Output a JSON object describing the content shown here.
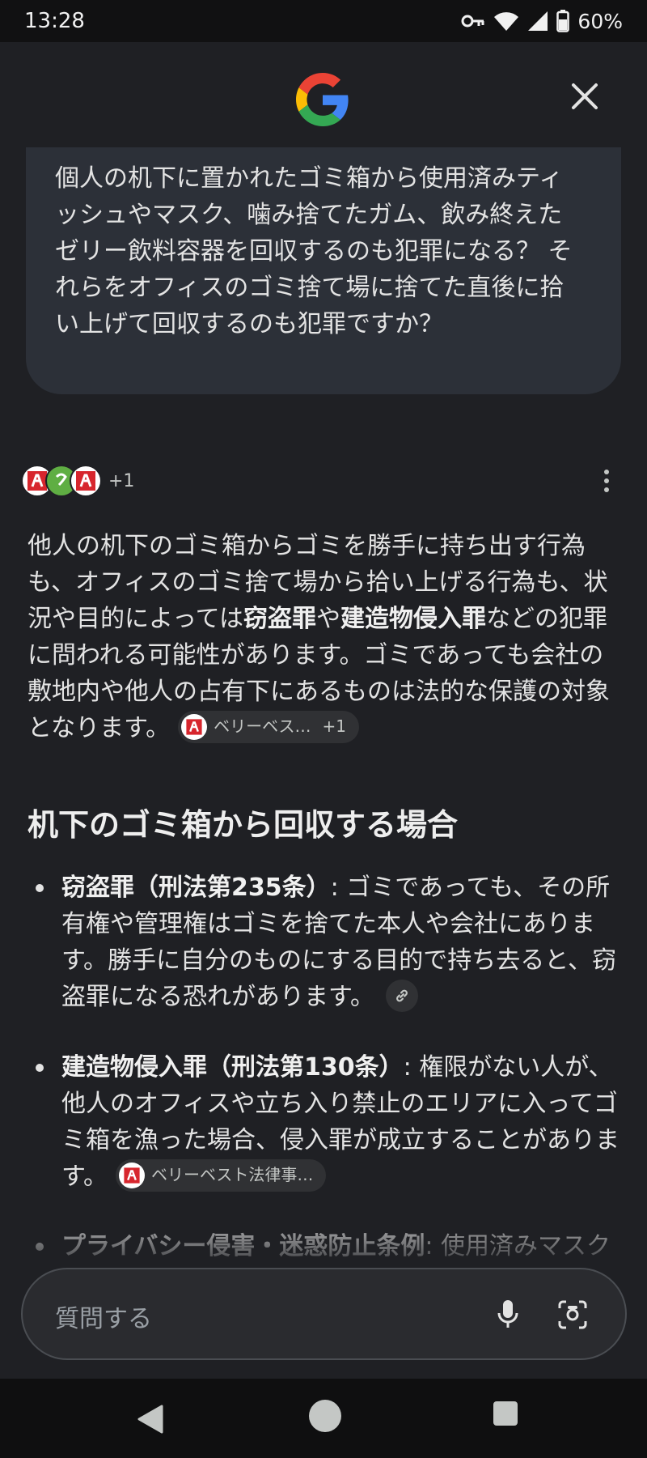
{
  "status_bar": {
    "time": "13:28",
    "battery": "60%",
    "icons": [
      "key-icon",
      "wifi-icon",
      "signal-icon",
      "battery-icon"
    ]
  },
  "header": {
    "logo": "google-g-logo",
    "close_icon": "close-icon"
  },
  "query": {
    "text": "個人の机下に置かれたゴミ箱から使用済みティッシュやマスク、噛み捨てたガム、飲み終えたゼリー飲料容器を回収するのも犯罪になる？ それらをオフィスのゴミ捨て場に捨てた直後に拾い上げて回収するのも犯罪ですか？"
  },
  "sources": {
    "count_label": "+1"
  },
  "answer": {
    "intro_before": "他人の机下のゴミ箱からゴミを勝手に持ち出す行為も、オフィスのゴミ捨て場から拾い上げる行為も、状況や目的によっては",
    "intro_bold_1": "窃盗罪",
    "intro_mid": "や",
    "intro_bold_2": "建造物侵入罪",
    "intro_after": "などの犯罪に問われる可能性があります。ゴミであっても会社の敷地内や他人の占有下にあるものは法的な保護の対象となります。",
    "intro_chip_label": "ベリーベス…",
    "intro_chip_count": "+1",
    "section_heading": "机下のゴミ箱から回収する場合",
    "bullets": [
      {
        "title": "窃盗罪（刑法第235条）",
        "text": ": ゴミであっても、その所有権や管理権はゴミを捨てた本人や会社にあります。勝手に自分のものにする目的で持ち去ると、窃盗罪になる恐れがあります。"
      },
      {
        "title": "建造物侵入罪（刑法第130条）",
        "text": ": 権限がない人が、他人のオフィスや立ち入り禁止のエリアに入ってゴミ箱を漁った場合、侵入罪が成立することがあります。",
        "chip_label": "ベリーベスト法律事…"
      },
      {
        "title": "プライバシー侵害・迷惑防止条例",
        "text": ": 使用済みマスクやティッシュなどを漁る行為は、ストーカ"
      }
    ]
  },
  "input": {
    "placeholder": "質問する"
  },
  "colors": {
    "background": "#1f2024",
    "bubble": "#2c3038",
    "text": "#e3e3e3"
  }
}
